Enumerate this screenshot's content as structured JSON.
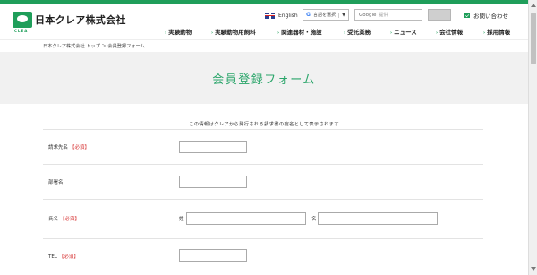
{
  "header": {
    "logo_mark_text": "CLEA",
    "logo_text": "日本クレア株式会社",
    "language_label": "English",
    "translate_g": "G",
    "translate_label": "言語を選択",
    "translate_arrow": "▼",
    "search_prefix": "Google",
    "search_placeholder": "提供",
    "contact_label": "お問い合わせ"
  },
  "nav": {
    "items": [
      {
        "label": "実験動物"
      },
      {
        "label": "実験動物用飼料"
      },
      {
        "label": "関連器材・施設"
      },
      {
        "label": "受託業務"
      },
      {
        "label": "ニュース"
      },
      {
        "label": "会社情報"
      },
      {
        "label": "採用情報"
      }
    ]
  },
  "breadcrumb": {
    "text": "日本クレア株式会社 トップ ＞ 会員登録フォーム"
  },
  "page": {
    "title": "会員登録フォーム",
    "notice": "この情報はクレアから発行される請求書の宛名として表示されます"
  },
  "form": {
    "required_label": "【必須】",
    "fields": [
      {
        "label": "請求先名",
        "required": true
      },
      {
        "label": "部署名",
        "required": false
      },
      {
        "label": "氏名",
        "required": true,
        "sub_labels": [
          "姓",
          "名"
        ]
      },
      {
        "label": "TEL",
        "required": true
      }
    ]
  },
  "icons": {
    "flag": "uk-flag-icon",
    "mail": "mail-icon",
    "nav_marker": "chevron-right-icon"
  },
  "colors": {
    "brand_green": "#1f9e5a",
    "title_green": "#2aa56a",
    "required_red": "#d63030",
    "hero_bg": "#f1f1f1"
  }
}
